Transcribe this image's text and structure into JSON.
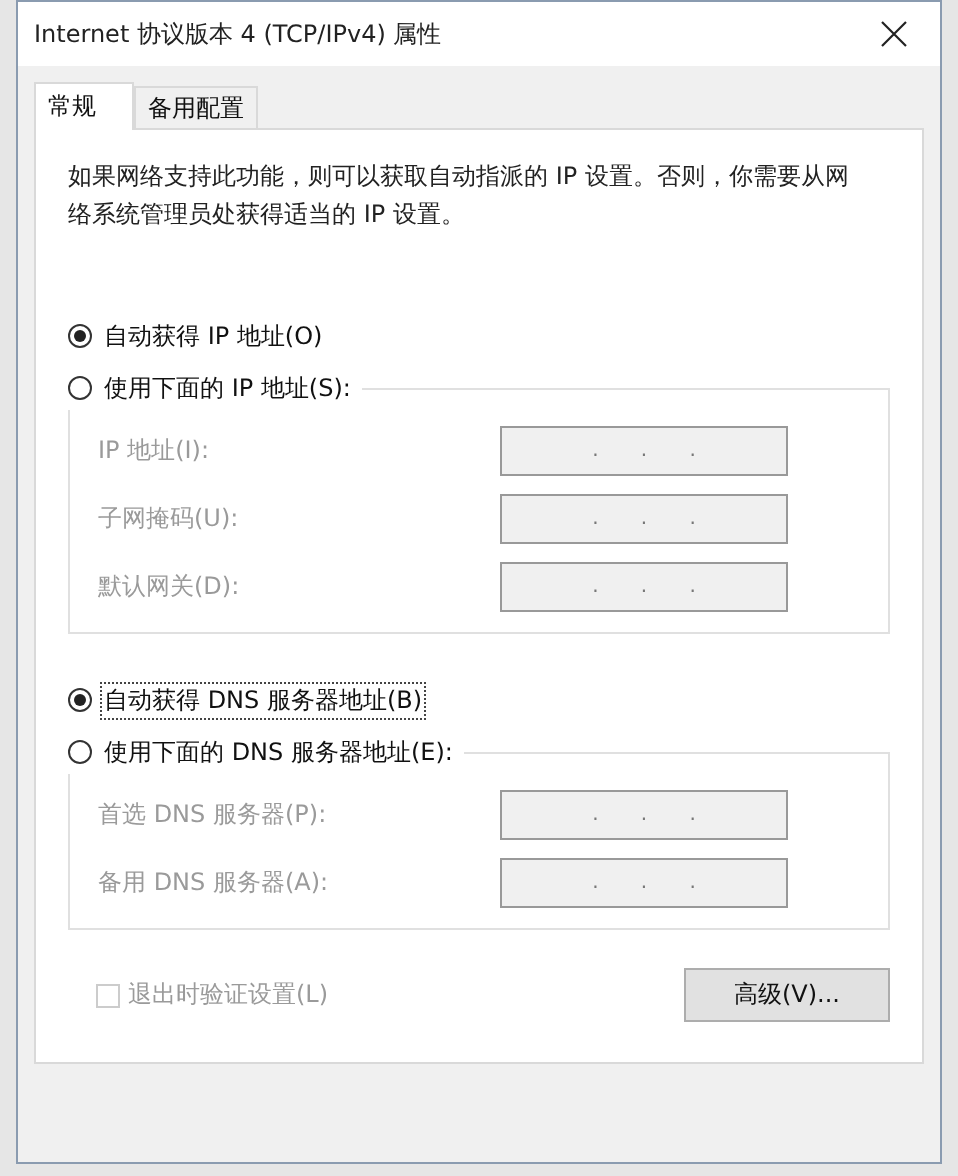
{
  "window": {
    "title": "Internet 协议版本 4 (TCP/IPv4) 属性"
  },
  "tabs": [
    {
      "label": "常规",
      "selected": true
    },
    {
      "label": "备用配置",
      "selected": false
    }
  ],
  "description": "如果网络支持此功能，则可以获取自动指派的 IP 设置。否则，你需要从网络系统管理员处获得适当的 IP 设置。",
  "groups": [
    {
      "options": [
        {
          "label": "自动获得 IP 地址(O)",
          "selected": true,
          "focused": false
        },
        {
          "label": "使用下面的 IP 地址(S):",
          "selected": false,
          "focused": false
        }
      ],
      "fields": [
        {
          "label": "IP 地址(I):",
          "disabled": true,
          "separators": [
            ".",
            ".",
            "."
          ]
        },
        {
          "label": "子网掩码(U):",
          "disabled": true,
          "separators": [
            ".",
            ".",
            "."
          ]
        },
        {
          "label": "默认网关(D):",
          "disabled": true,
          "separators": [
            ".",
            ".",
            "."
          ]
        }
      ]
    },
    {
      "options": [
        {
          "label": "自动获得 DNS 服务器地址(B)",
          "selected": true,
          "focused": true
        },
        {
          "label": "使用下面的 DNS 服务器地址(E):",
          "selected": false,
          "focused": false
        }
      ],
      "fields": [
        {
          "label": "首选 DNS 服务器(P):",
          "disabled": true,
          "separators": [
            ".",
            ".",
            "."
          ]
        },
        {
          "label": "备用 DNS 服务器(A):",
          "disabled": true,
          "separators": [
            ".",
            ".",
            "."
          ]
        }
      ]
    }
  ],
  "validate_checkbox": {
    "label": "退出时验证设置(L)",
    "checked": false,
    "disabled": true
  },
  "advanced_button": {
    "label": "高级(V)..."
  }
}
